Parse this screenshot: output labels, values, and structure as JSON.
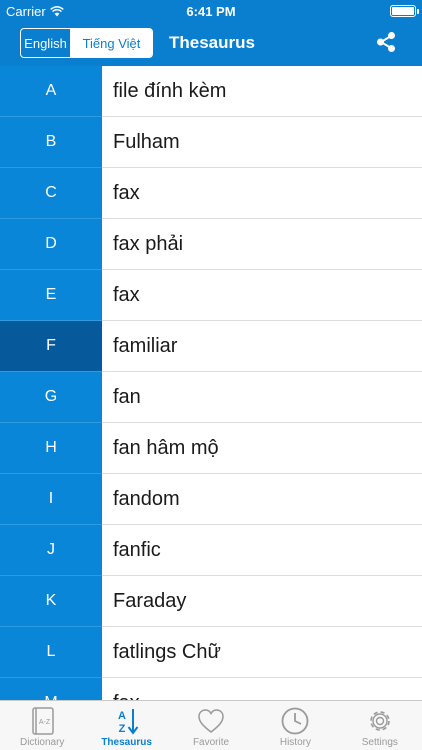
{
  "status": {
    "carrier": "Carrier",
    "time": "6:41 PM"
  },
  "header": {
    "segments": {
      "english": "English",
      "vietnamese": "Tiếng Việt"
    },
    "title": "Thesaurus"
  },
  "rows": [
    {
      "letter": "A",
      "word": "file đính kèm"
    },
    {
      "letter": "B",
      "word": "Fulham"
    },
    {
      "letter": "C",
      "word": "fax"
    },
    {
      "letter": "D",
      "word": "fax phải"
    },
    {
      "letter": "E",
      "word": "fax"
    },
    {
      "letter": "F",
      "word": "familiar"
    },
    {
      "letter": "G",
      "word": "fan"
    },
    {
      "letter": "H",
      "word": "fan hâm mộ"
    },
    {
      "letter": "I",
      "word": "fandom"
    },
    {
      "letter": "J",
      "word": "fanfic"
    },
    {
      "letter": "K",
      "word": "Faraday"
    },
    {
      "letter": "L",
      "word": "fatlings Chữ"
    },
    {
      "letter": "M",
      "word": "fax"
    }
  ],
  "tabs": {
    "dictionary": "Dictionary",
    "thesaurus": "Thesaurus",
    "favorite": "Favorite",
    "history": "History",
    "settings": "Settings"
  },
  "colors": {
    "primary": "#0a7fd0",
    "letter_bg": "#0a86d8",
    "letter_active": "#06599a"
  }
}
